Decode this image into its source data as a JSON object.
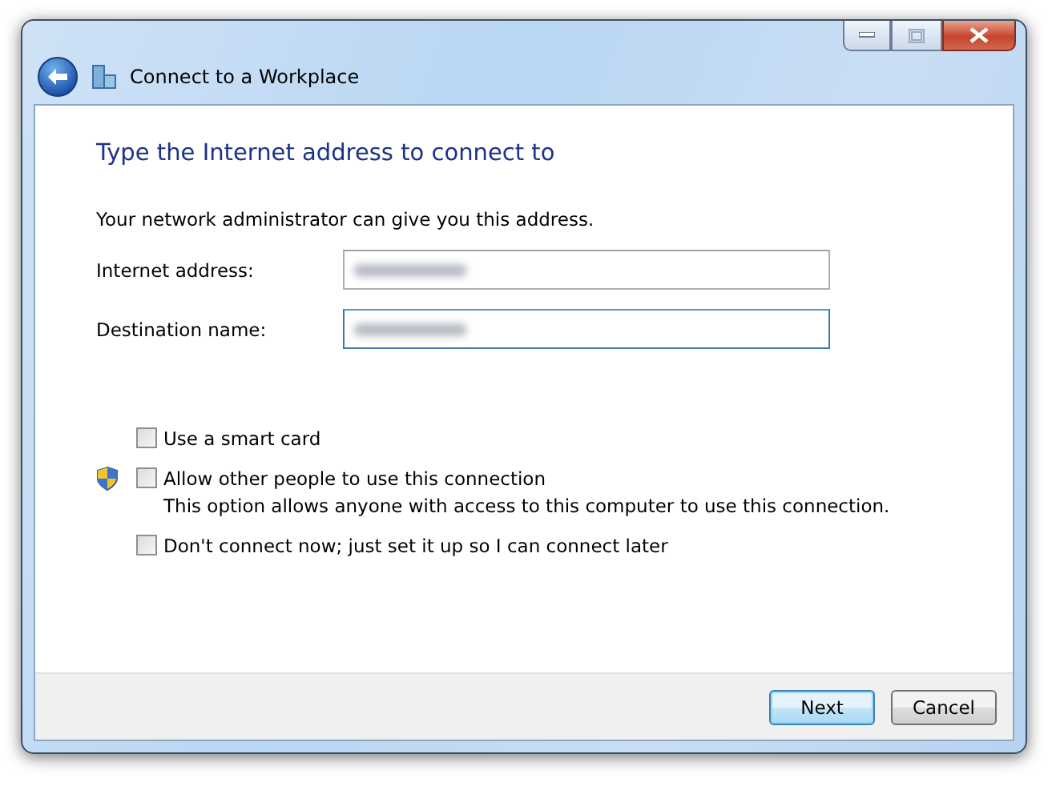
{
  "window": {
    "title": "Connect to a Workplace"
  },
  "heading": "Type the Internet address to connect to",
  "intro": "Your network administrator can give you this address.",
  "fields": [
    {
      "label": "Internet address:",
      "redacted": true,
      "focused": false
    },
    {
      "label": "Destination name:",
      "redacted": true,
      "focused": true
    }
  ],
  "options": [
    {
      "label": "Use a smart card",
      "checked": false,
      "shield": false
    },
    {
      "label": "Allow other people to use this connection",
      "note": "This option allows anyone with access to this computer to use this connection.",
      "checked": false,
      "shield": true
    },
    {
      "label": "Don't connect now; just set it up so I can connect later",
      "checked": false,
      "shield": false
    }
  ],
  "buttons": [
    {
      "label": "Next",
      "default": true
    },
    {
      "label": "Cancel",
      "default": false
    }
  ]
}
